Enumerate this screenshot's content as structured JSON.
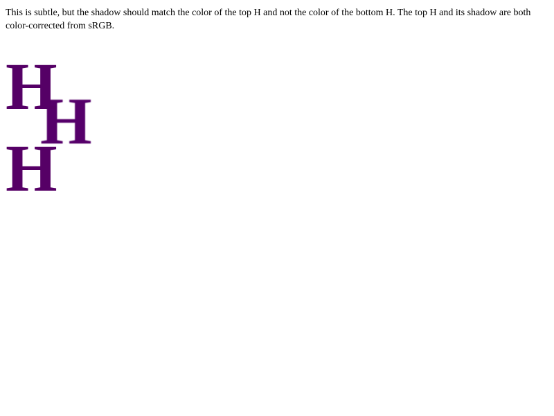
{
  "page": {
    "description_text": "This is subtle, but the shadow should match the color of the top H and not the color of the bottom H. The top H and its shadow are both color-corrected from sRGB."
  },
  "glyphs": {
    "top": "H",
    "shadow": "H",
    "bottom": "H"
  },
  "colors": {
    "top_h": "#550066",
    "shadow_h": "#56006a",
    "bottom_h": "#560066",
    "background": "#ffffff",
    "text": "#000000"
  }
}
